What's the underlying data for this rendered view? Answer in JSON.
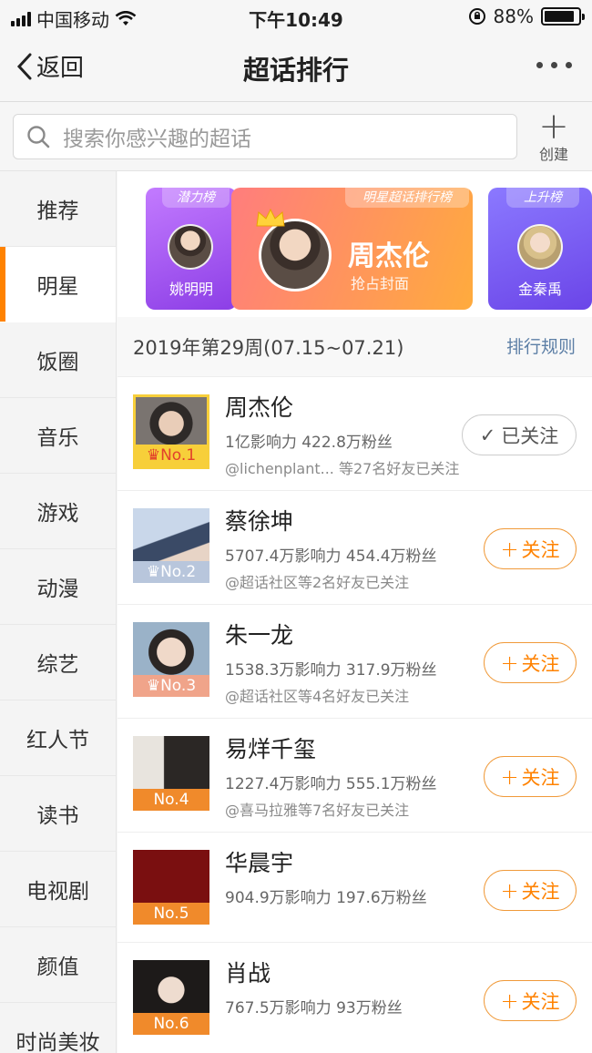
{
  "status": {
    "carrier": "中国移动",
    "time": "下午10:49",
    "battery": "88%",
    "battery_level": 0.88
  },
  "nav": {
    "back_label": "返回",
    "title": "超话排行"
  },
  "search": {
    "placeholder": "搜索你感兴趣的超话",
    "create_label": "创建"
  },
  "sidebar": {
    "items": [
      "推荐",
      "明星",
      "饭圈",
      "音乐",
      "游戏",
      "动漫",
      "综艺",
      "红人节",
      "读书",
      "电视剧",
      "颜值",
      "时尚美妆"
    ],
    "active": "明星"
  },
  "banners": {
    "left": {
      "tag": "潜力榜",
      "name": "姚明明"
    },
    "center": {
      "tag": "明星超话排行榜",
      "name": "周杰伦",
      "subtitle": "抢占封面"
    },
    "right": {
      "tag": "上升榜",
      "name": "金秦禹"
    }
  },
  "week": {
    "label": "2019年第29周(07.15~07.21)",
    "rules": "排行规则"
  },
  "ranking": [
    {
      "rank": "No.1",
      "name": "周杰伦",
      "stats": "1亿影响力 422.8万粉丝",
      "friends": "@lichenplant...   等27名好友已关注",
      "action": "已关注",
      "followed": true
    },
    {
      "rank": "No.2",
      "name": "蔡徐坤",
      "stats": "5707.4万影响力 454.4万粉丝",
      "friends": "@超话社区等2名好友已关注",
      "action": "关注",
      "followed": false
    },
    {
      "rank": "No.3",
      "name": "朱一龙",
      "stats": "1538.3万影响力 317.9万粉丝",
      "friends": "@超话社区等4名好友已关注",
      "action": "关注",
      "followed": false
    },
    {
      "rank": "No.4",
      "name": "易烊千玺",
      "stats": "1227.4万影响力 555.1万粉丝",
      "friends": "@喜马拉雅等7名好友已关注",
      "action": "关注",
      "followed": false
    },
    {
      "rank": "No.5",
      "name": "华晨宇",
      "stats": "904.9万影响力 197.6万粉丝",
      "friends": "",
      "action": "关注",
      "followed": false
    },
    {
      "rank": "No.6",
      "name": "肖战",
      "stats": "767.5万影响力 93万粉丝",
      "friends": "",
      "action": "关注",
      "followed": false
    }
  ],
  "colors": {
    "accent": "#ff8200",
    "link": "#5d7fa6",
    "gold": "#f7cf3a"
  }
}
